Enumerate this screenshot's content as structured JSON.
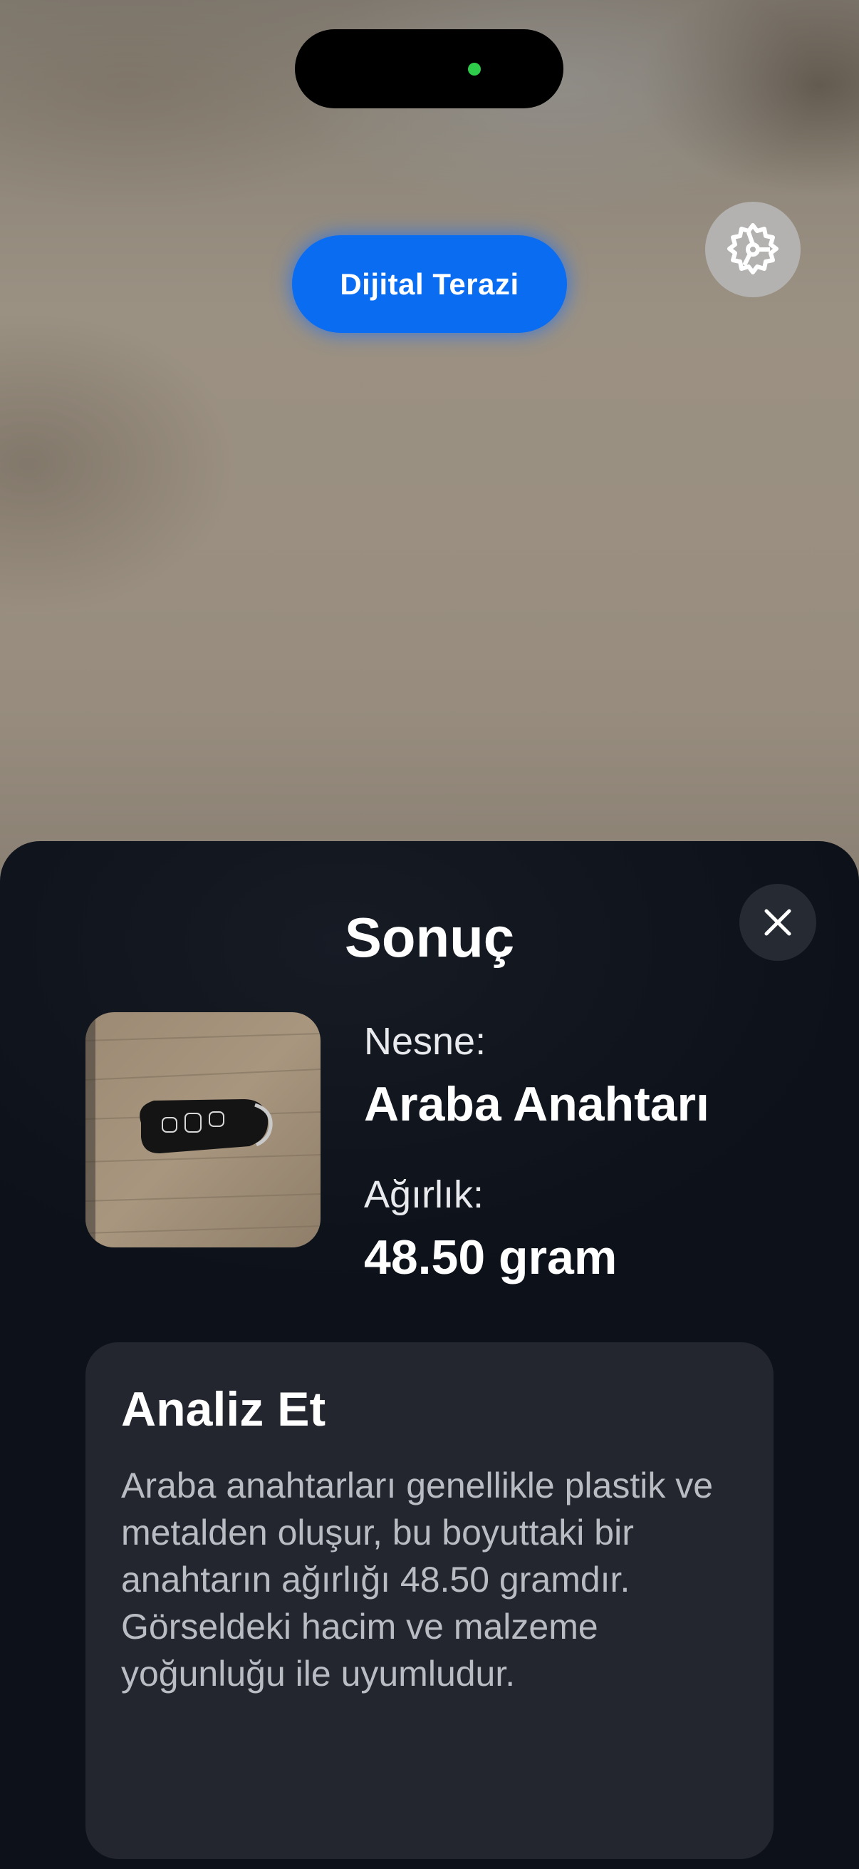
{
  "header": {
    "mode_label": "Dijital Terazi",
    "settings_icon": "settings-icon"
  },
  "colors": {
    "accent": "#0a6cf0",
    "sheet_bg": "#0d1119",
    "card_bg": "#23262e",
    "status_dot": "#2ecc4a"
  },
  "result": {
    "title": "Sonuç",
    "close_icon": "close-icon",
    "object_label": "Nesne:",
    "object_value": "Araba Anahtarı",
    "weight_label": "Ağırlık:",
    "weight_value": "48.50 gram",
    "image_subject": "car key fob on wooden table"
  },
  "analysis": {
    "title": "Analiz Et",
    "body": "Araba anahtarları genellikle plastik ve metalden oluşur, bu boyuttaki bir anahtarın ağırlığı 48.50 gramdır. Görseldeki hacim ve malzeme yoğunluğu ile uyumludur."
  }
}
